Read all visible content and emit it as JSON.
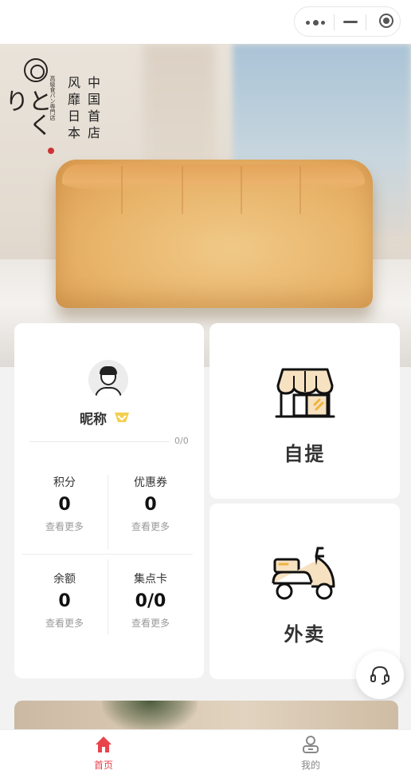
{
  "capsule": {
    "more_icon": "more-dots-icon",
    "minimize_icon": "minus-icon",
    "close_icon": "target-icon"
  },
  "hero": {
    "logo_script": "とくり",
    "logo_small_text": "高級食パン専門店",
    "slogan_line1": "中国首店",
    "slogan_line2": "风靡日本"
  },
  "user": {
    "nickname": "昵称",
    "progress": "0/0",
    "stats": [
      {
        "label": "积分",
        "value": "0",
        "more": "查看更多"
      },
      {
        "label": "优惠券",
        "value": "0",
        "more": "查看更多"
      },
      {
        "label": "余额",
        "value": "0",
        "more": "查看更多"
      },
      {
        "label": "集点卡",
        "value": "0/0",
        "more": "查看更多"
      }
    ]
  },
  "services": {
    "pickup_label": "自提",
    "delivery_label": "外卖"
  },
  "tabbar": {
    "home_label": "首页",
    "mine_label": "我的"
  },
  "colors": {
    "accent": "#e8434b",
    "cream": "#f6e1c1",
    "gold": "#f0c542"
  }
}
